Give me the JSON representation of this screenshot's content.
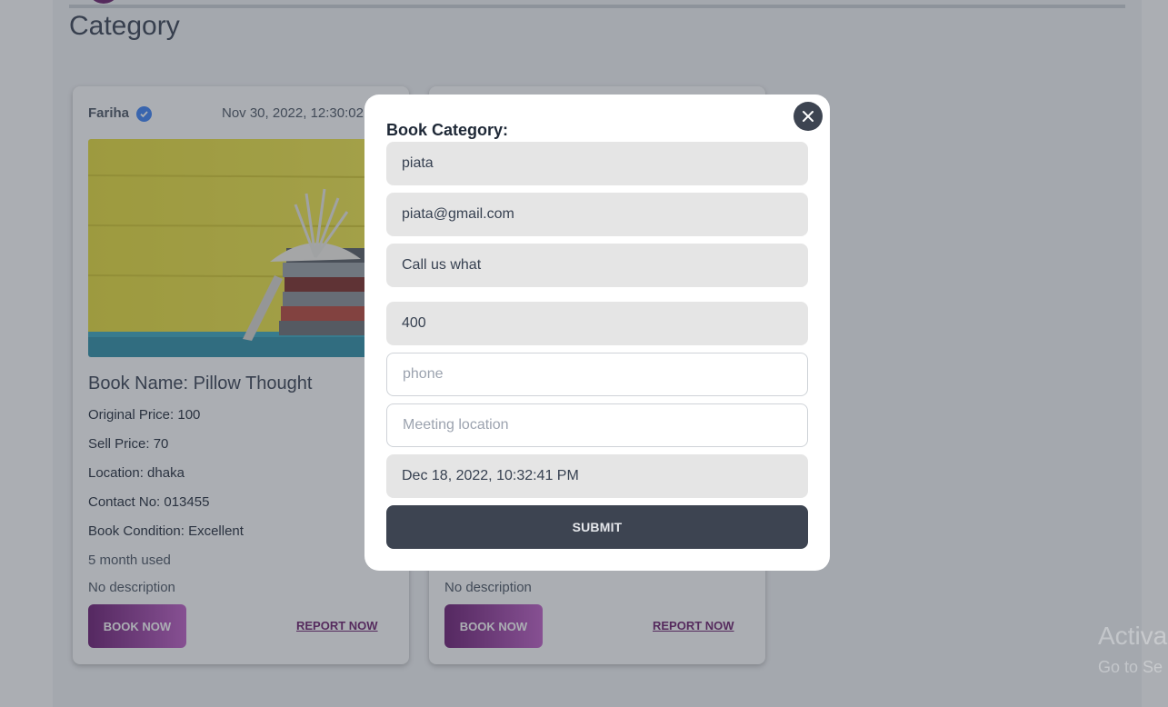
{
  "page": {
    "title": "Category"
  },
  "cards": [
    {
      "seller": "Fariha",
      "date": "Nov 30, 2022, 12:30:02",
      "book_name": "Book Name: Pillow Thought",
      "original_price": "Original Price: 100",
      "sell_price": "Sell Price: 70",
      "location": "Location: dhaka",
      "contact": "Contact No: 013455",
      "condition": "Book Condition: Excellent",
      "used": "5 month used",
      "description": "No description",
      "book_label": "BOOK NOW",
      "report_label": "REPORT NOW"
    },
    {
      "description": "No description",
      "book_label": "BOOK NOW",
      "report_label": "REPORT NOW"
    }
  ],
  "modal": {
    "label": "Book Category:",
    "name": "piata",
    "email": "piata@gmail.com",
    "book": "Call us what",
    "price": "400",
    "phone_placeholder": "phone",
    "location_placeholder": "Meeting location",
    "date": "Dec 18, 2022, 10:32:41 PM",
    "submit_label": "SUBMIT"
  },
  "watermark": {
    "line1": "Activa",
    "line2": "Go to Se"
  },
  "colors": {
    "accent": "#6b1d6b",
    "dark_button": "#3d4451"
  }
}
